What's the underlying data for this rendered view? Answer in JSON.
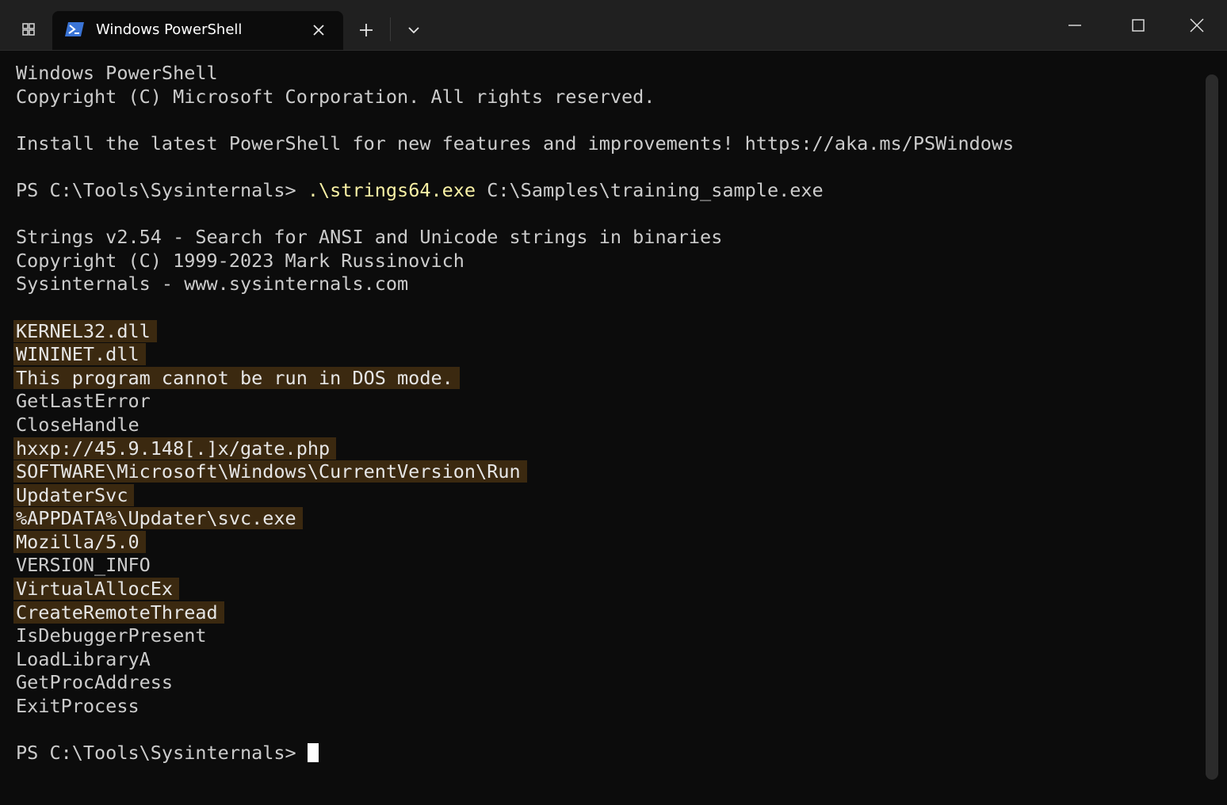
{
  "titlebar": {
    "tab_title": "Windows PowerShell"
  },
  "terminal": {
    "header_line1": "Windows PowerShell",
    "header_line2": "Copyright (C) Microsoft Corporation. All rights reserved.",
    "install_line": "Install the latest PowerShell for new features and improvements! https://aka.ms/PSWindows",
    "prompt": "PS C:\\Tools\\Sysinternals> ",
    "command_exe": ".\\strings64.exe",
    "command_arg": " C:\\Samples\\training_sample.exe",
    "banner_line1": "Strings v2.54 - Search for ANSI and Unicode strings in binaries",
    "banner_line2": "Copyright (C) 1999-2023 Mark Russinovich",
    "banner_line3": "Sysinternals - www.sysinternals.com",
    "output": [
      "KERNEL32.dll",
      "WININET.dll",
      "This program cannot be run in DOS mode.",
      "GetLastError",
      "CloseHandle",
      "hxxp://45.9.148[.]x/gate.php",
      "SOFTWARE\\Microsoft\\Windows\\CurrentVersion\\Run",
      "UpdaterSvc",
      "%APPDATA%\\Updater\\svc.exe",
      "Mozilla/5.0",
      "VERSION_INFO",
      "VirtualAllocEx",
      "CreateRemoteThread",
      "IsDebuggerPresent",
      "LoadLibraryA",
      "GetProcAddress",
      "ExitProcess"
    ],
    "final_prompt": "PS C:\\Tools\\Sysinternals> "
  },
  "colors": {
    "background": "#0c0c0c",
    "text": "#cccccc",
    "command": "#f9f1a5",
    "highlight": "#3b2910",
    "titlebar": "#202020"
  }
}
